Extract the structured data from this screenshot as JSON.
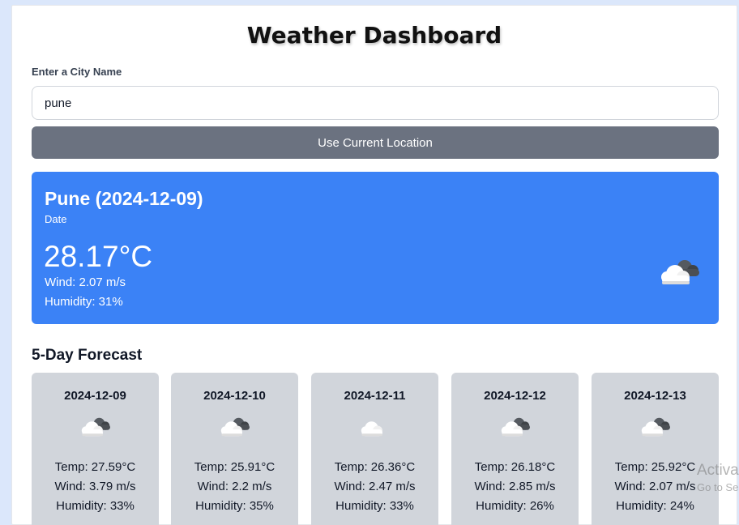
{
  "app": {
    "title": "Weather Dashboard"
  },
  "search": {
    "label": "Enter a City Name",
    "value": "pune",
    "location_button": "Use Current Location"
  },
  "current": {
    "heading": "Pune (2024-12-09)",
    "date_label": "Date",
    "temperature": "28.17°C",
    "wind": "Wind: 2.07 m/s",
    "humidity": "Humidity: 31%",
    "icon": "broken-clouds-icon",
    "bg_color": "#3b82f6"
  },
  "forecast": {
    "title": "5-Day Forecast",
    "days": [
      {
        "date": "2024-12-09",
        "icon": "broken-clouds-icon",
        "temp": "Temp: 27.59°C",
        "wind": "Wind: 3.79 m/s",
        "humidity": "Humidity: 33%"
      },
      {
        "date": "2024-12-10",
        "icon": "broken-clouds-icon",
        "temp": "Temp: 25.91°C",
        "wind": "Wind: 2.2 m/s",
        "humidity": "Humidity: 35%"
      },
      {
        "date": "2024-12-11",
        "icon": "cloud-icon",
        "temp": "Temp: 26.36°C",
        "wind": "Wind: 2.47 m/s",
        "humidity": "Humidity: 33%"
      },
      {
        "date": "2024-12-12",
        "icon": "broken-clouds-icon",
        "temp": "Temp: 26.18°C",
        "wind": "Wind: 2.85 m/s",
        "humidity": "Humidity: 26%"
      },
      {
        "date": "2024-12-13",
        "icon": "broken-clouds-icon",
        "temp": "Temp: 25.92°C",
        "wind": "Wind: 2.07 m/s",
        "humidity": "Humidity: 24%"
      }
    ],
    "card_color": "#d1d5db"
  },
  "os_overlay": {
    "line1": "Activa",
    "line2": "Go to Se"
  }
}
